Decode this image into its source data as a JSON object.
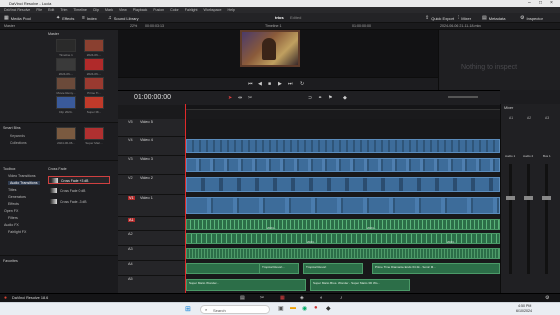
{
  "title_bar": {
    "title": "DaVinci Resolve - Lucia"
  },
  "menu": [
    "DaVinci Resolve",
    "File",
    "Edit",
    "Trim",
    "Timeline",
    "Clip",
    "Mark",
    "View",
    "Playback",
    "Fusion",
    "Color",
    "Fairlight",
    "Workspace",
    "Help"
  ],
  "toolbar": {
    "media_pool": "Media Pool",
    "effects": "Effects",
    "index": "Index",
    "sound_library": "Sound Library",
    "project_title": "trios",
    "edited": "Edited",
    "quick_export": "Quick Export",
    "mixer": "Mixer",
    "metadata": "Metadata",
    "inspector": "Inspector"
  },
  "viewer_bar": {
    "zoom": "22%",
    "timecode_left": "00:00:03:13",
    "timeline_name": "Timeline 1",
    "timecode_right": "01:00:00:00",
    "clip_name": "2024-06-06 21-11-18.mkv"
  },
  "media_pool": {
    "master": "Master",
    "section": "Master",
    "clips": [
      "Timeline 1",
      "2024-06-...",
      "2024-06-...",
      "2024-06-...",
      "2024-06-...",
      "2024-06-...",
      "2024-06-...",
      "Ma...",
      "Movie Remy...",
      "Prime Ti...",
      "Clip 2024..",
      "Super Mi..."
    ],
    "smart_bins": "Smart Bins",
    "bins": [
      "Keywords",
      "Collections"
    ],
    "extra_clips": [
      "2024-06-06...",
      "RPGa...",
      "Super Mari..."
    ]
  },
  "effects": {
    "toolbox": "Toolbox",
    "items": [
      "Video Transitions",
      "Audio Transitions",
      "Titles",
      "Generators",
      "Effects",
      "Open FX",
      "Filters",
      "Audio FX",
      "Fairlight FX"
    ],
    "panel_title": "Cross Fade",
    "fades": [
      "Cross Fade +3 dB",
      "Cross Fade 0 dB",
      "Cross Fade -3 dB"
    ],
    "favorites": "Favorites"
  },
  "inspector": {
    "empty_text": "Nothing to inspect"
  },
  "timeline": {
    "timecode": "01:00:00:00",
    "tracks": [
      {
        "id": "V5",
        "name": "Video 5"
      },
      {
        "id": "V4",
        "name": "Video 4"
      },
      {
        "id": "V3",
        "name": "Video 3"
      },
      {
        "id": "V2",
        "name": "Video 2"
      },
      {
        "id": "V1",
        "name": "Video 1"
      },
      {
        "id": "A1",
        "name": ""
      },
      {
        "id": "A2",
        "name": ""
      },
      {
        "id": "A3",
        "name": ""
      },
      {
        "id": "A4",
        "name": ""
      },
      {
        "id": "A5",
        "name": ""
      }
    ],
    "clip_labels": [
      "Prime Time Diamante Ends 64 2k - Sonic M...",
      "Super Mario Wonder...",
      "Tropical Resort...",
      "Tropical Resort",
      "Super Mario Bros. Wonder - Super Mario 3D Wo...",
      "Best Parts Compil...",
      "2024...",
      "2024...",
      "2024...",
      "2024..."
    ]
  },
  "mixer": {
    "title": "Mixer",
    "channels": [
      "A1",
      "A2",
      "A3"
    ],
    "labels": [
      "Audio 1",
      "Audio 2",
      "Bus 1"
    ]
  },
  "footer": {
    "app": "DaVinci Resolve 18.6"
  },
  "taskbar": {
    "search": "Search",
    "time": "4:50 PM",
    "date": "6/10/2024"
  }
}
